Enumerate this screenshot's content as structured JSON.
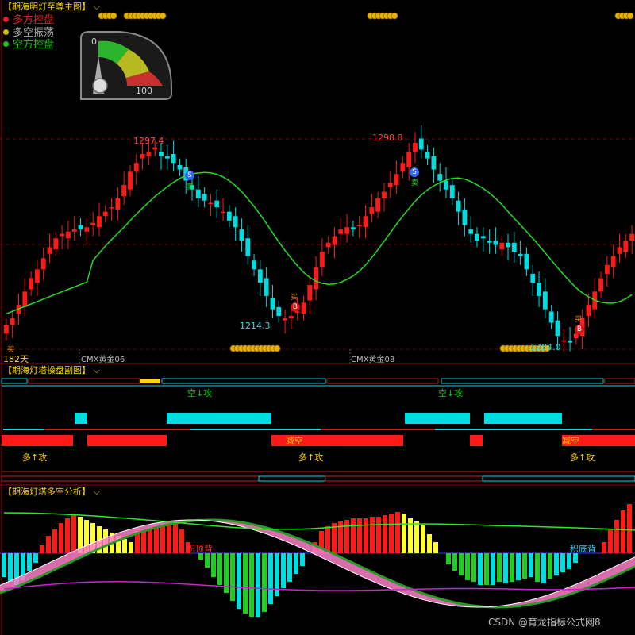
{
  "main_panel": {
    "title": "【期海明灯至尊主图】",
    "legend": [
      {
        "label": "多方控盘",
        "color": "#e02020"
      },
      {
        "label": "多空振荡",
        "color": "#c8c000"
      },
      {
        "label": "空方控盘",
        "color": "#20c020"
      }
    ],
    "gauge": {
      "min_label": "0",
      "max_label": "100"
    },
    "price_labels": {
      "high1": "1297.4",
      "high2": "1298.8",
      "low1": "1214.3",
      "low2": "1204.0"
    },
    "days_label": "182天",
    "contract_labels": [
      "CMX黄金06",
      "CMX黄金08"
    ],
    "sell_badge": "S",
    "buy_badge": "B",
    "sell_glyph": "卖",
    "buy_glyph": "买"
  },
  "sub_panel_1": {
    "title": "【期海灯塔操盘副图】",
    "short_attack": "空↓攻",
    "long_attack": "多↑攻",
    "reduce_short": "减空"
  },
  "sub_panel_2": {
    "title": "【期海灯塔多空分析】",
    "bottom_divergence": "积底背",
    "top_divergence": "积顶背"
  },
  "watermark": "CSDN @育龙指标公式网8",
  "colors": {
    "up": "#ff1a1a",
    "down": "#00dde0",
    "ma": "#22dd22",
    "title": "#ffd400",
    "pink": "#ff7fc8",
    "green_band": "#2a9a2a",
    "yellow": "#ffff33",
    "magenta": "#d020d0"
  },
  "chart_data": {
    "type": "candlestick",
    "price_range": [
      1204.0,
      1298.8
    ],
    "annotated_highs": [
      1297.4,
      1298.8
    ],
    "annotated_lows": [
      1214.3,
      1204.0
    ],
    "period_label": "182天",
    "series": [
      "CMX黄金06",
      "CMX黄金08"
    ]
  }
}
